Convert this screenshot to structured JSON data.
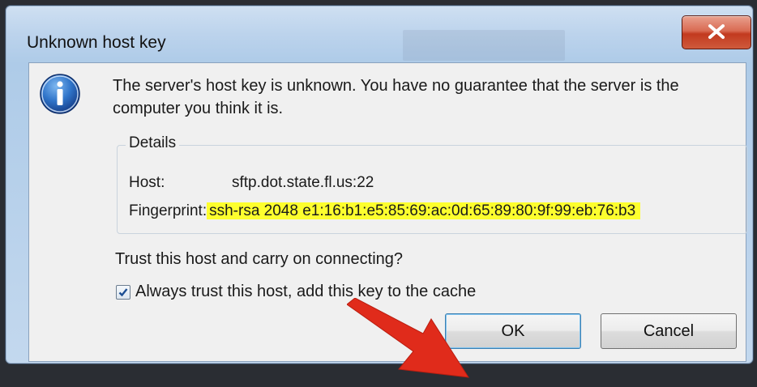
{
  "dialog": {
    "title": "Unknown host key",
    "message": "The server's host key is unknown. You have no guarantee that the server is the computer you think it is.",
    "details": {
      "legend": "Details",
      "host_label": "Host:",
      "host_value": "sftp.dot.state.fl.us:22",
      "fingerprint_label": "Fingerprint:",
      "fingerprint_value": "ssh-rsa 2048 e1:16:b1:e5:85:69:ac:0d:65:89:80:9f:99:eb:76:b3"
    },
    "question": "Trust this host and carry on connecting?",
    "checkbox": {
      "label": "Always trust this host, add this key to the cache",
      "checked": true
    },
    "buttons": {
      "ok": "OK",
      "cancel": "Cancel"
    }
  },
  "icons": {
    "info": "info-icon",
    "close": "close-icon",
    "annotation": "red-arrow"
  },
  "colors": {
    "highlight": "#fdff2e",
    "arrow": "#e02b1b",
    "close_button": "#c9432a"
  }
}
